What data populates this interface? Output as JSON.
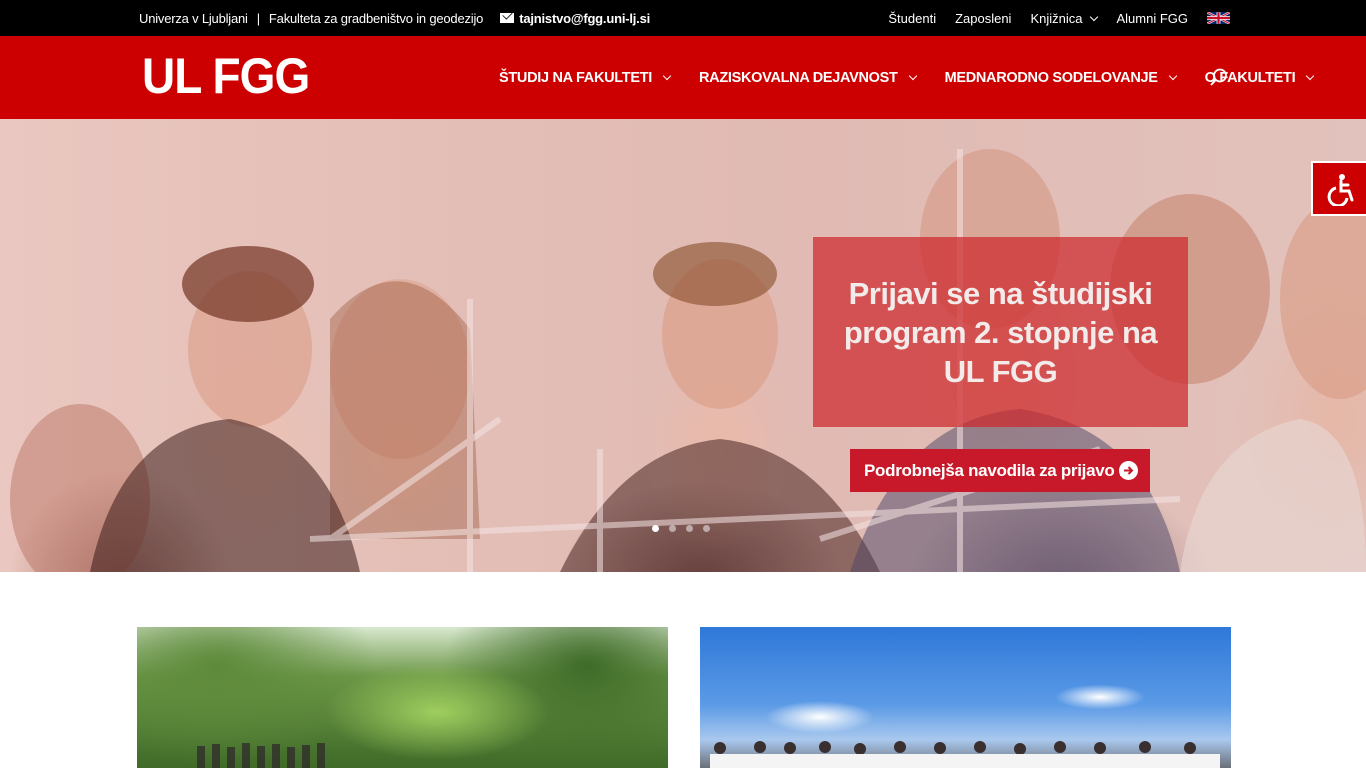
{
  "topbar": {
    "university": "Univerza v Ljubljani",
    "separator": "|",
    "faculty": "Fakulteta za gradbeništvo in geodezijo",
    "email": "tajnistvo@fgg.uni-lj.si",
    "links": [
      "Študenti",
      "Zaposleni",
      "Knjižnica",
      "Alumni FGG"
    ],
    "language_flag": "uk-flag-icon"
  },
  "header": {
    "logo": "UL FGG",
    "nav": [
      {
        "label": "ŠTUDIJ NA FAKULTETI"
      },
      {
        "label": "RAZISKOVALNA DEJAVNOST"
      },
      {
        "label": "MEDNARODNO SODELOVANJE"
      },
      {
        "label": "O FAKULTETI"
      }
    ]
  },
  "hero": {
    "title": "Prijavi se na študijski program 2. stopnje na UL FGG",
    "button": "Podrobnejša navodila za prijavo ...",
    "slides": 4,
    "active_slide": 1
  },
  "colors": {
    "brand_red": "#cc0000",
    "topbar": "#000000"
  }
}
